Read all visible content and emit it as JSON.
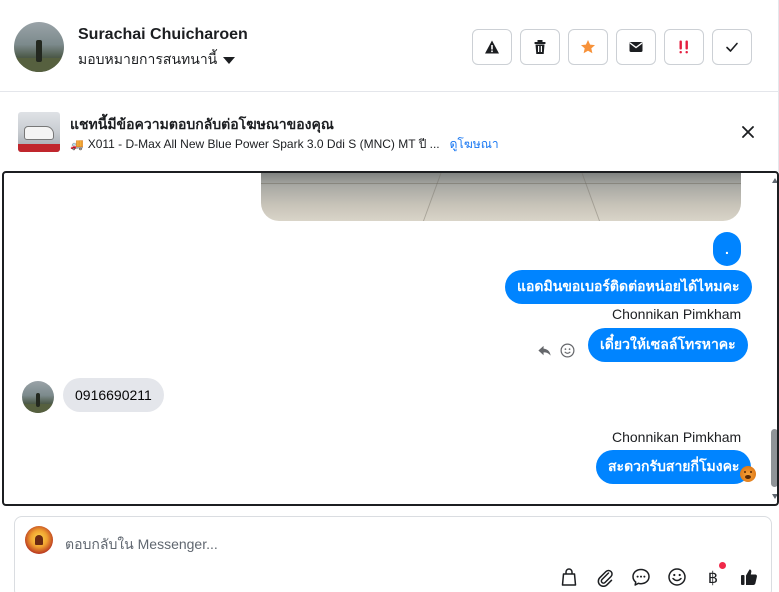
{
  "header": {
    "user_name": "Surachai Chuicharoen",
    "assign_label": "มอบหมายการสนทนานี้",
    "actions": [
      {
        "name": "spam-icon",
        "color": "#1c1e21"
      },
      {
        "name": "trash-icon",
        "color": "#1c1e21"
      },
      {
        "name": "star-icon",
        "color": "#f7923a"
      },
      {
        "name": "envelope-icon",
        "color": "#1c1e21"
      },
      {
        "name": "follow-up-icon",
        "color": "#e41e3f"
      },
      {
        "name": "checkmark-icon",
        "color": "#1c1e21"
      }
    ]
  },
  "ad": {
    "title": "แชทนี้มีข้อความตอบกลับต่อโฆษณาของคุณ",
    "subtitle": "X011 - D-Max All New Blue Power Spark 3.0 Ddi S (MNC) MT ปี ...",
    "link": "ดูโฆษณา"
  },
  "chat": {
    "messages": [
      {
        "from": "page",
        "text": "."
      },
      {
        "from": "page",
        "text": "แอดมินขอเบอร์ติดต่อหน่อยได้ไหมคะ"
      },
      {
        "from": "page",
        "sender": "Chonnikan Pimkham",
        "text": "เดี๋ยวให้เซลล์โทรหาคะ"
      },
      {
        "from": "user",
        "text": "0916690211"
      },
      {
        "from": "page",
        "sender": "Chonnikan Pimkham",
        "text": "สะดวกรับสายกี่โมงคะ"
      }
    ]
  },
  "composer": {
    "placeholder": "ตอบกลับใน Messenger...",
    "tools": [
      "shopping-bag-icon",
      "paperclip-icon",
      "saved-reply-icon",
      "emoji-icon",
      "baht-icon",
      "thumbs-up-icon"
    ],
    "baht_symbol": "฿"
  },
  "colors": {
    "accent": "#0084ff",
    "link": "#1877f2",
    "incoming_bubble": "#e4e6eb"
  }
}
